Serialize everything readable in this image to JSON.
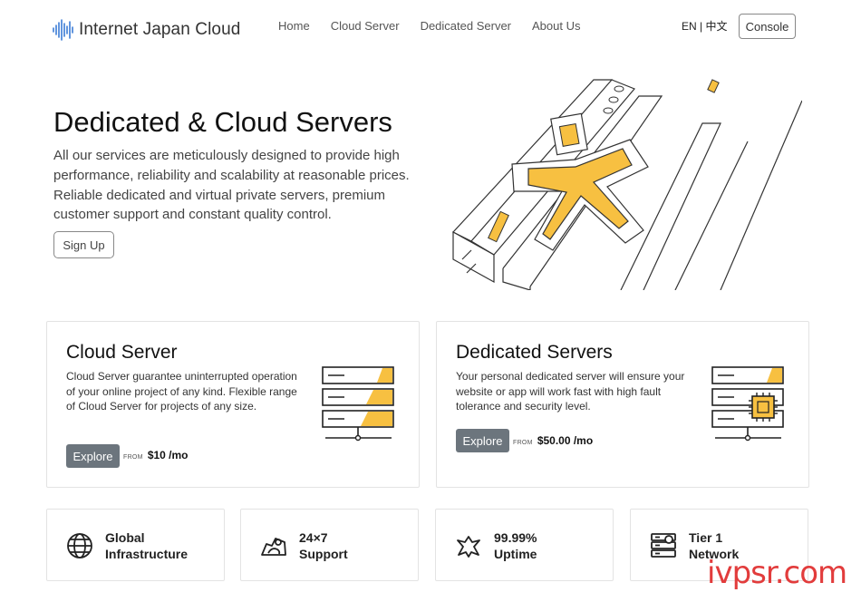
{
  "header": {
    "logo_text": "Internet Japan Cloud",
    "nav": [
      "Home",
      "Cloud Server",
      "Dedicated Server",
      "About Us"
    ],
    "lang": "EN | 中文",
    "console_label": "Console"
  },
  "hero": {
    "title": "Dedicated & Cloud Servers",
    "description": "All our services are meticulously designed to provide high performance, reliability and scalability at reasonable prices. Reliable dedicated and virtual private servers, premium customer support and constant quality control.",
    "signup_label": "Sign Up"
  },
  "products": [
    {
      "title": "Cloud Server",
      "description": "Cloud Server guarantee uninterrupted operation of your online project of any kind. Flexible range of Cloud Server for projects of any size.",
      "explore_label": "Explore",
      "from_label": "FROM",
      "price": "$10 /mo",
      "icon": "server-rack-icon"
    },
    {
      "title": "Dedicated Servers",
      "description": "Your personal dedicated server will ensure your website or app will work fast with high fault tolerance and security level.",
      "explore_label": "Explore",
      "from_label": "FROM",
      "price": "$50.00 /mo",
      "icon": "server-chip-icon"
    }
  ],
  "features": [
    {
      "line1": "Global",
      "line2": "Infrastructure",
      "icon": "globe-icon"
    },
    {
      "line1": "24×7",
      "line2": "Support",
      "icon": "support-icon"
    },
    {
      "line1": "99.99%",
      "line2": "Uptime",
      "icon": "uptime-icon"
    },
    {
      "line1": "Tier 1",
      "line2": "Network",
      "icon": "network-icon"
    }
  ],
  "watermark": "ivpsr.com",
  "colors": {
    "accent": "#f7c041",
    "button_gray": "#6c757d",
    "logo_blue": "#3a7bd5",
    "watermark": "#e23c3c"
  }
}
